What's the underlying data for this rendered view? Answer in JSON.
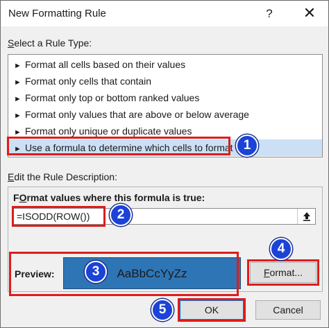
{
  "window": {
    "title": "New Formatting Rule",
    "help_glyph": "?",
    "close_glyph": "✕"
  },
  "rule_type": {
    "label_accel": "S",
    "label_rest": "elect a Rule Type:",
    "arrow_glyph": "►",
    "items": [
      {
        "label": "Format all cells based on their values"
      },
      {
        "label": "Format only cells that contain"
      },
      {
        "label": "Format only top or bottom ranked values"
      },
      {
        "label": "Format only values that are above or below average"
      },
      {
        "label": "Format only unique or duplicate values"
      },
      {
        "label": "Use a formula to determine which cells to format",
        "selected": true
      }
    ]
  },
  "description": {
    "label_accel": "E",
    "label_rest": "dit the Rule Description:",
    "formula_label_accel": "O",
    "formula_label_pre": "F",
    "formula_label_rest": "rmat values where this formula is true:",
    "formula_value": "=ISODD(ROW())",
    "preview_label": "Preview:",
    "preview_sample": "AaBbCcYyZz",
    "preview_fill": "#2e75b6",
    "format_button_accel": "F",
    "format_button_rest": "ormat..."
  },
  "buttons": {
    "ok": "OK",
    "cancel": "Cancel"
  },
  "annotations": {
    "highlight_color": "#e01b1b",
    "badge_color": "#1b43d8",
    "badges": [
      "1",
      "2",
      "3",
      "4",
      "5"
    ]
  }
}
